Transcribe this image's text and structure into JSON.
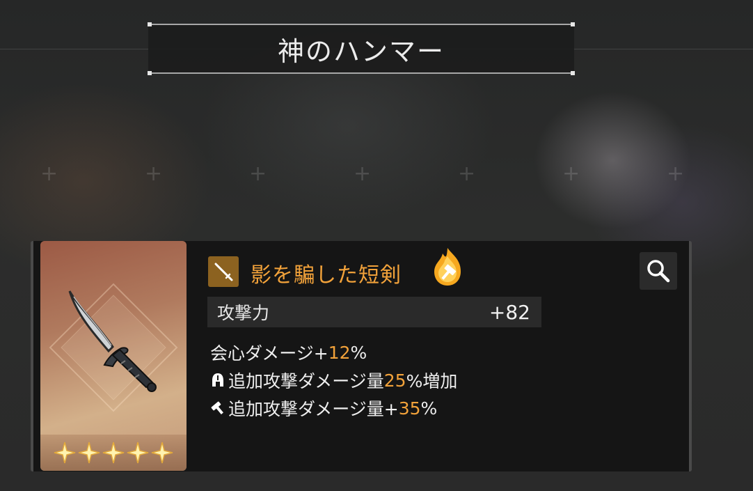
{
  "header": {
    "title": "神のハンマー"
  },
  "item": {
    "name": "影を騙した短剣",
    "rarity_stars": 5,
    "weapon_type_icon": "dagger-icon",
    "element_icon": "flame-hammer-icon"
  },
  "stats": {
    "label": "攻撃力",
    "value": "+82"
  },
  "effects": [
    {
      "icon": "",
      "prefix": "会心ダメージ+",
      "value": "12",
      "suffix": "%"
    },
    {
      "icon": "helmet-icon",
      "prefix": "追加攻撃ダメージ量",
      "value": "25",
      "suffix": "%増加"
    },
    {
      "icon": "hammer-icon",
      "prefix": "追加攻撃ダメージ量+",
      "value": "35",
      "suffix": "%"
    }
  ],
  "colors": {
    "accent": "#f2a23a",
    "card_bg": "#151515",
    "type_badge": "#8c6220"
  }
}
